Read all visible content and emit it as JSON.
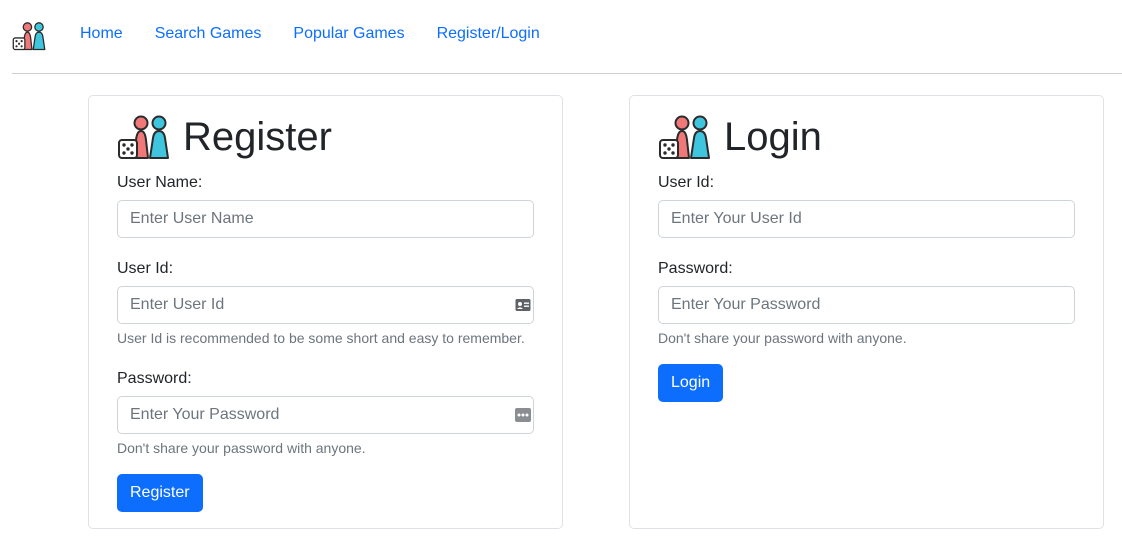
{
  "nav": {
    "logo_icon": "board-game-pawns-icon",
    "links": [
      "Home",
      "Search Games",
      "Popular Games",
      "Register/Login"
    ]
  },
  "register": {
    "title": "Register",
    "username_label": "User Name:",
    "username_placeholder": "Enter User Name",
    "userid_label": "User Id:",
    "userid_placeholder": "Enter User Id",
    "userid_help": "User Id is recommended to be some short and easy to remember.",
    "password_label": "Password:",
    "password_placeholder": "Enter Your Password",
    "password_help": "Don't share your password with anyone.",
    "button_label": "Register"
  },
  "login": {
    "title": "Login",
    "userid_label": "User Id:",
    "userid_placeholder": "Enter Your User Id",
    "password_label": "Password:",
    "password_placeholder": "Enter Your Password",
    "password_help": "Don't share your password with anyone.",
    "button_label": "Login"
  },
  "colors": {
    "link": "#0d6efd",
    "button": "#0d6efd",
    "pawn_red": "#f07878",
    "pawn_cyan": "#3fc6de"
  }
}
